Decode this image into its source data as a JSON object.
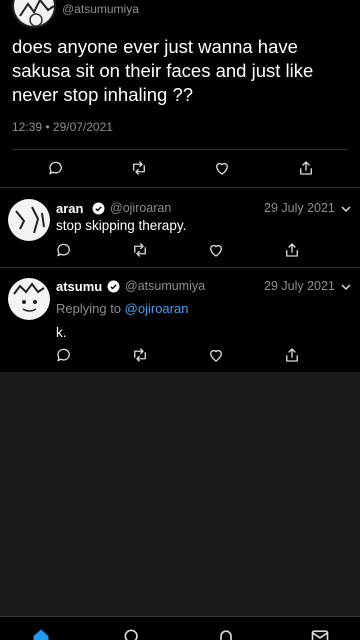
{
  "tweet": {
    "author_handle": "@atsumumiya",
    "text": "does anyone ever just wanna have sakusa sit on their faces and just like never stop inhaling ??",
    "timestamp": "12:39 • 29/07/2021"
  },
  "replies": [
    {
      "name": "aran",
      "handle": "@ojiroaran",
      "date": "29 July 2021",
      "replying_prefix": "",
      "replying_mention": "",
      "text": "stop skipping therapy."
    },
    {
      "name": "atsumu",
      "handle": "@atsumumiya",
      "date": "29 July 2021",
      "replying_prefix": "Replying to ",
      "replying_mention": "@ojiroaran",
      "text": "k."
    }
  ],
  "icons": {
    "reply": "comment-icon",
    "retweet": "retweet-icon",
    "like": "heart-icon",
    "share": "share-icon",
    "verified": "verified-badge-icon",
    "more": "chevron-down-icon",
    "tabs": [
      "home-icon",
      "search-icon",
      "notifications-icon",
      "messages-icon"
    ]
  },
  "colors": {
    "background": "#000000",
    "empty_area": "#1b1b1d",
    "secondary_text": "#8b8f93",
    "mention": "#4c9eeb",
    "active_tab": "#1d9bf0"
  }
}
